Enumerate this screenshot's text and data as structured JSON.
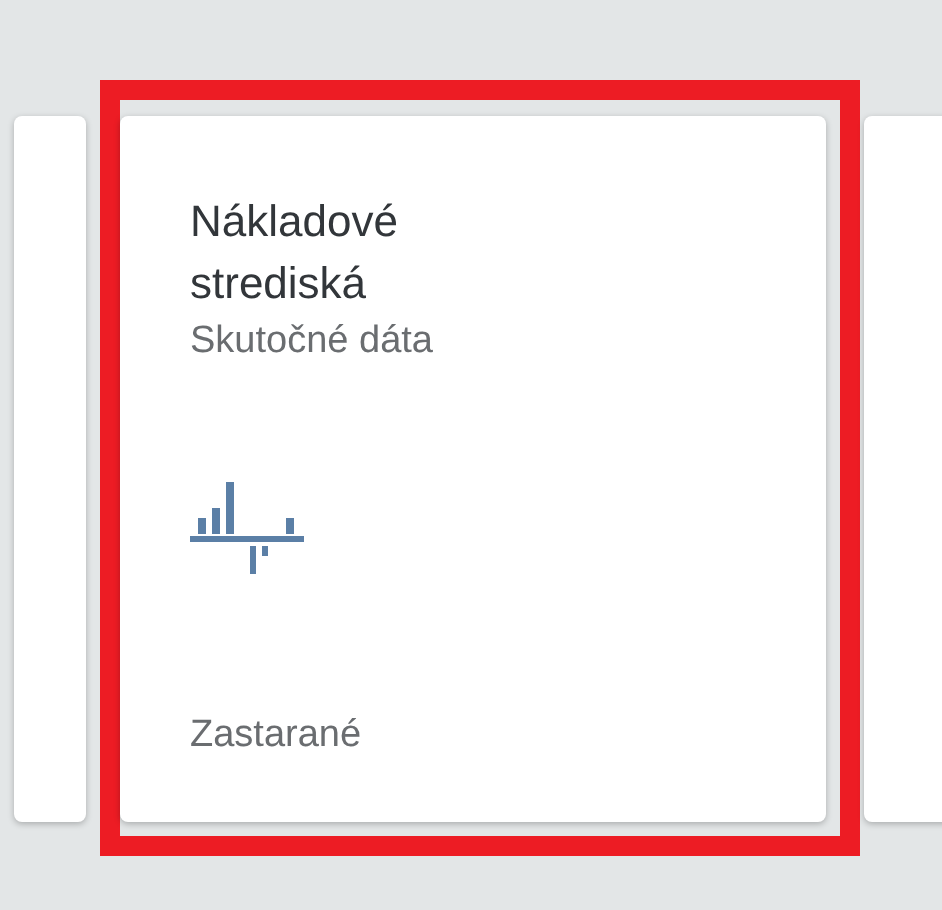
{
  "tiles": [
    {
      "title": "Nákladové strediská",
      "subtitle": "Skutočné dáta",
      "footer": "Zastarané",
      "selected": true
    }
  ]
}
